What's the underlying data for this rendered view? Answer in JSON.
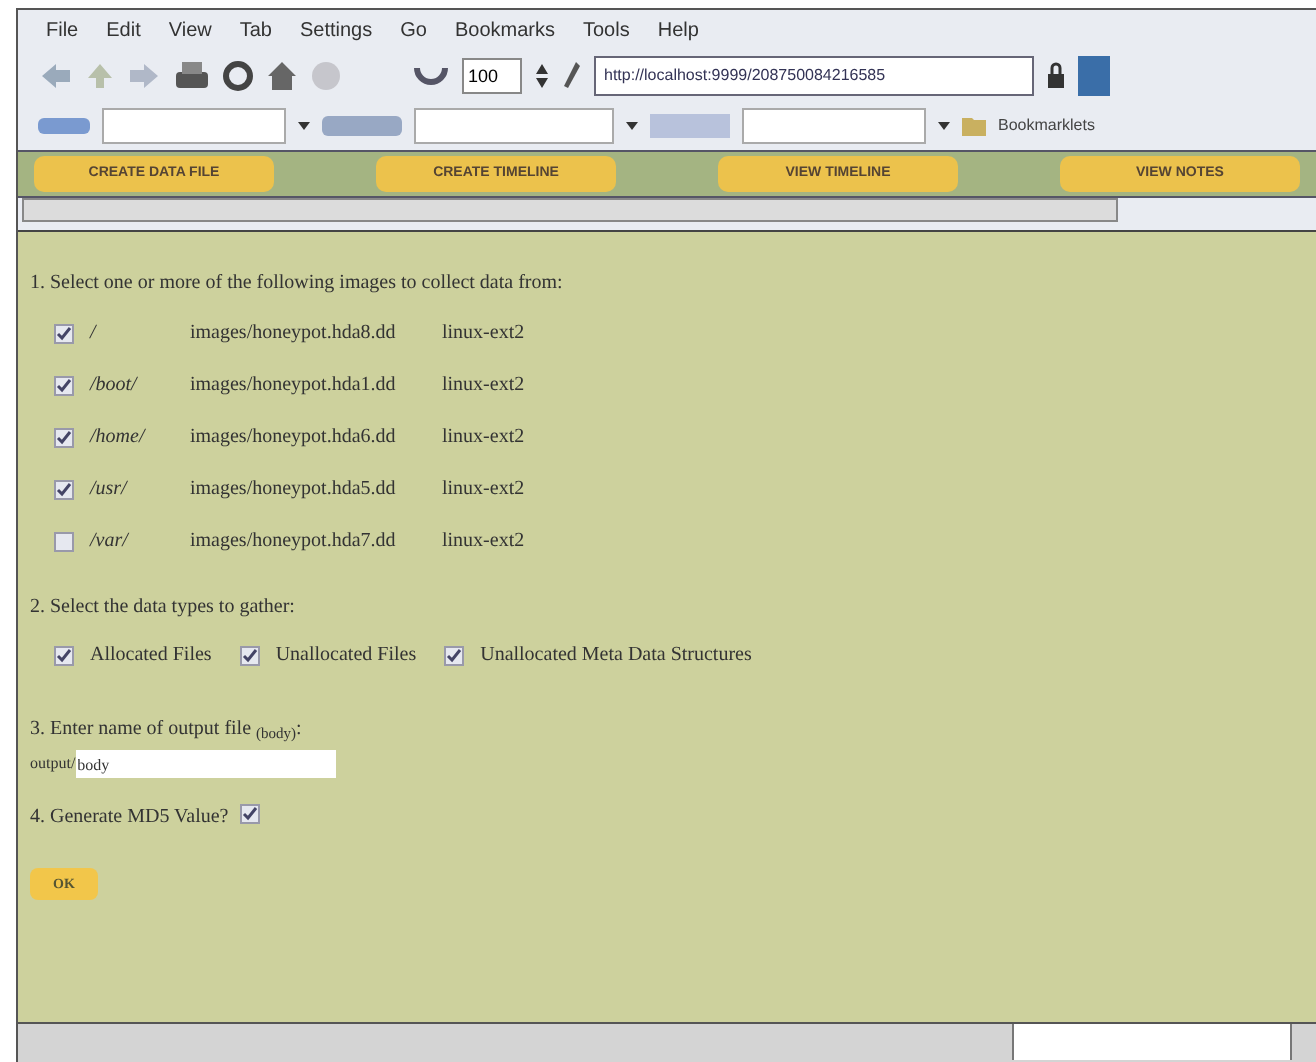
{
  "menu_bar": [
    "File",
    "Edit",
    "View",
    "Tab",
    "Settings",
    "Go",
    "Bookmarks",
    "Tools",
    "Help"
  ],
  "toolbar": {
    "zoom": "100",
    "url": "http://localhost:9999/208750084216585"
  },
  "search_bar": {
    "bookmarks_label": "Bookmarklets"
  },
  "nav_buttons": [
    {
      "label": "CREATE DATA FILE"
    },
    {
      "label": "CREATE TIMELINE"
    },
    {
      "label": "VIEW TIMELINE"
    },
    {
      "label": "VIEW NOTES"
    }
  ],
  "form": {
    "step_1": "1. Select one or more of the following images to collect data from:",
    "images": [
      {
        "mount": "/",
        "path": "images/honeypot.hda8.dd",
        "fs": "linux-ext2",
        "checked": true
      },
      {
        "mount": "/boot/",
        "path": "images/honeypot.hda1.dd",
        "fs": "linux-ext2",
        "checked": true
      },
      {
        "mount": "/home/",
        "path": "images/honeypot.hda6.dd",
        "fs": "linux-ext2",
        "checked": true
      },
      {
        "mount": "/usr/",
        "path": "images/honeypot.hda5.dd",
        "fs": "linux-ext2",
        "checked": true
      },
      {
        "mount": "/var/",
        "path": "images/honeypot.hda7.dd",
        "fs": "linux-ext2",
        "checked": false
      }
    ],
    "step_2": "2. Select the data types to gather:",
    "data_types": [
      {
        "label": "Allocated Files",
        "checked": true
      },
      {
        "label": "Unallocated Files",
        "checked": true
      },
      {
        "label": "Unallocated Meta Data Structures",
        "checked": true
      }
    ],
    "step_3": "3. Enter name of output file $_{(body)}$:",
    "output_prefix": "output/",
    "output_value": "body",
    "step_4": "4. Generate MD5 Value?",
    "md5_checked": true,
    "ok_button": "OK"
  }
}
